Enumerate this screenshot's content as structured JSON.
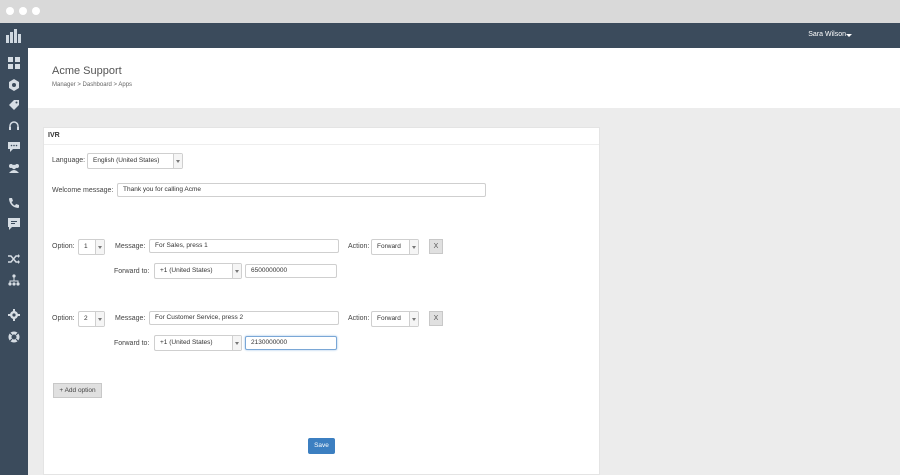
{
  "topnav": {
    "user_name": "Sara Wilson"
  },
  "sidebar": {
    "icons": [
      "grid-icon",
      "hexagon-icon",
      "tag-icon",
      "headset-icon",
      "chat-icon",
      "users-icon",
      "phone-icon",
      "message-icon",
      "shuffle-icon",
      "hierarchy-icon",
      "gear-icon",
      "lifebuoy-icon"
    ]
  },
  "header": {
    "title": "Acme Support",
    "breadcrumb": "Manager > Dashboard > Apps"
  },
  "ivr": {
    "title": "IVR",
    "language_label": "Language:",
    "language_value": "English (United States)",
    "welcome_label": "Welcome message:",
    "welcome_value": "Thank you for calling Acme",
    "options": [
      {
        "option_label": "Option:",
        "number": "1",
        "message_label": "Message:",
        "message": "For Sales, press 1",
        "action_label": "Action:",
        "action": "Forward",
        "remove": "X",
        "forward_label": "Forward to:",
        "country": "+1 (United States)",
        "phone": "6500000000"
      },
      {
        "option_label": "Option:",
        "number": "2",
        "message_label": "Message:",
        "message": "For Customer Service, press 2",
        "action_label": "Action:",
        "action": "Forward",
        "remove": "X",
        "forward_label": "Forward to:",
        "country": "+1 (United States)",
        "phone": "2130000000"
      }
    ],
    "add_option": "+ Add option",
    "save": "Save"
  }
}
